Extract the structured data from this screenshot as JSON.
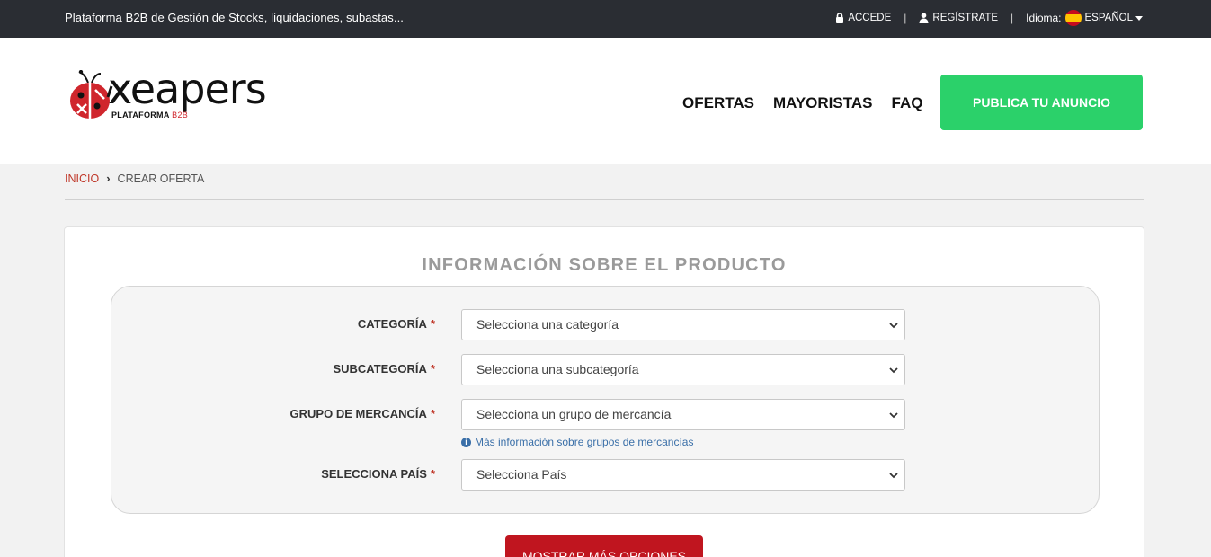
{
  "topbar": {
    "tagline": "Plataforma B2B de Gestión de Stocks, liquidaciones, subastas...",
    "login": "ACCEDE",
    "register": "REGÍSTRATE",
    "language_label": "Idioma:",
    "language_value": "ESPAÑOL"
  },
  "header": {
    "logo_word": "xeapers",
    "logo_sub": "PLATAFORMA",
    "logo_sub_accent": "B2B",
    "nav": [
      "OFERTAS",
      "MAYORISTAS",
      "FAQ"
    ],
    "cta": "PUBLICA TU ANUNCIO"
  },
  "breadcrumb": {
    "home": "INICIO",
    "current": "CREAR OFERTA"
  },
  "form": {
    "title": "INFORMACIÓN SOBRE EL PRODUCTO",
    "fields": [
      {
        "label": "CATEGORÍA",
        "required": "*",
        "placeholder": "Selecciona una categoría"
      },
      {
        "label": "SUBCATEGORÍA",
        "required": "*",
        "placeholder": "Selecciona una subcategoría"
      },
      {
        "label": "GRUPO DE MERCANCÍA",
        "required": "*",
        "placeholder": "Selecciona un grupo de mercancía"
      },
      {
        "label": "SELECCIONA PAÍS",
        "required": "*",
        "placeholder": "Selecciona País"
      }
    ],
    "info_link": "Más información sobre grupos de mercancías",
    "more_button": "MOSTRAR MÁS OPCIONES"
  },
  "colors": {
    "topbar_bg": "#2a2d33",
    "cta_green": "#2bd16a",
    "brand_red": "#c0151f"
  }
}
